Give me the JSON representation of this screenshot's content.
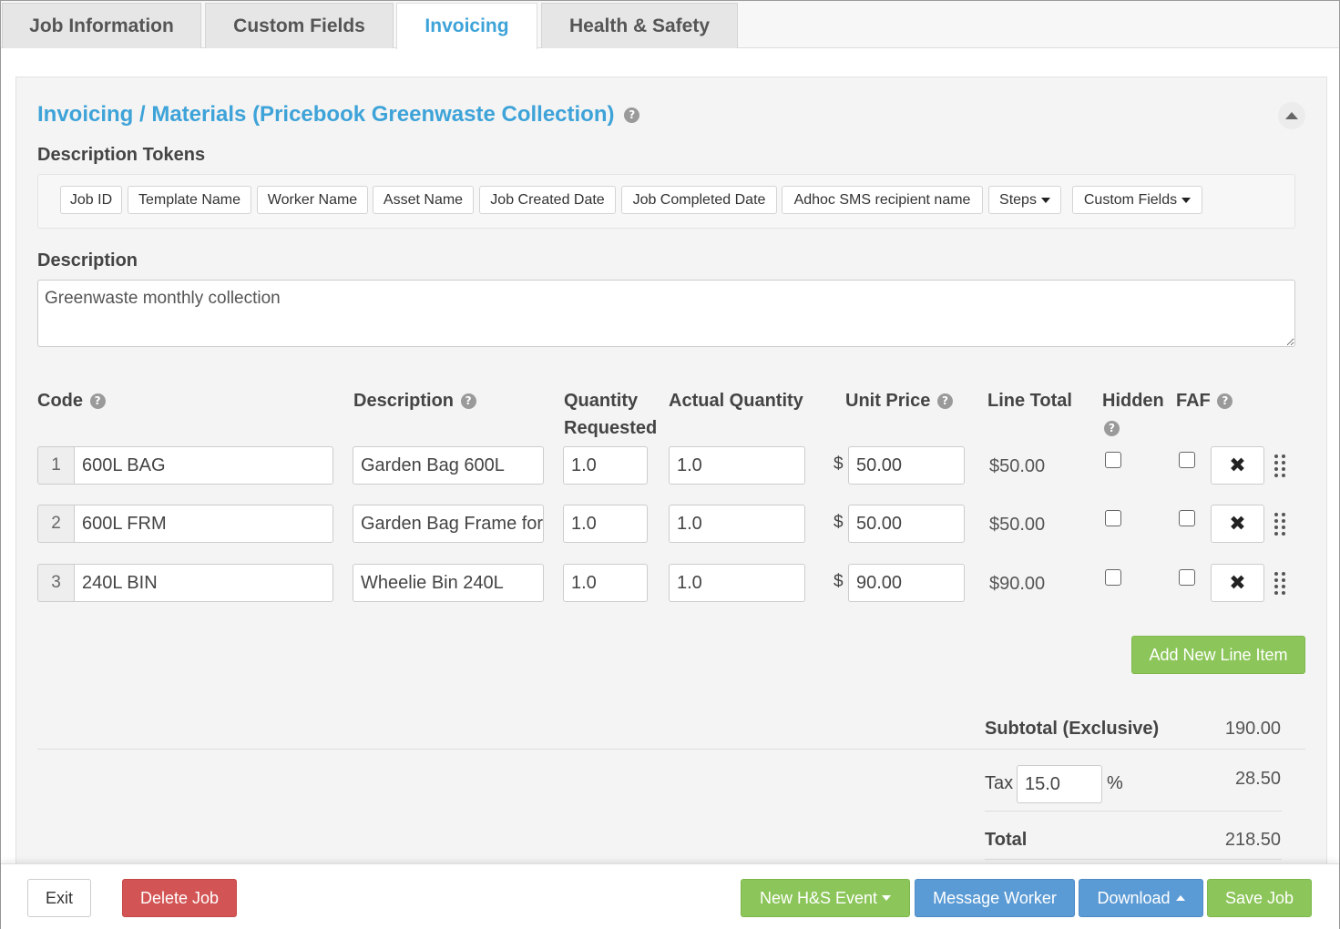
{
  "tabs": [
    {
      "label": "Job Information"
    },
    {
      "label": "Custom Fields"
    },
    {
      "label": "Invoicing",
      "active": true
    },
    {
      "label": "Health & Safety"
    }
  ],
  "section": {
    "title": "Invoicing / Materials (Pricebook Greenwaste Collection)",
    "help": "?"
  },
  "tokens": {
    "label": "Description Tokens",
    "items": [
      "Job ID",
      "Template Name",
      "Worker Name",
      "Asset Name",
      "Job Created Date",
      "Job Completed Date",
      "Adhoc SMS recipient name"
    ],
    "dropdowns": [
      "Steps",
      "Custom Fields"
    ]
  },
  "description": {
    "label": "Description",
    "value": "Greenwaste monthly collection"
  },
  "columns": {
    "code": "Code",
    "description": "Description",
    "qty_requested_1": "Quantity",
    "qty_requested_2": "Requested",
    "actual_quantity": "Actual Quantity",
    "unit_price": "Unit Price",
    "line_total": "Line Total",
    "hidden": "Hidden",
    "faf": "FAF"
  },
  "currency_symbol": "$",
  "line_items": [
    {
      "num": "1",
      "code": "600L BAG",
      "description": "Garden Bag 600L",
      "qty_requested": "1.0",
      "actual_qty": "1.0",
      "unit_price": "50.00",
      "line_total": "$50.00"
    },
    {
      "num": "2",
      "code": "600L FRM",
      "description": "Garden Bag Frame for",
      "qty_requested": "1.0",
      "actual_qty": "1.0",
      "unit_price": "50.00",
      "line_total": "$50.00"
    },
    {
      "num": "3",
      "code": "240L BIN",
      "description": "Wheelie Bin 240L",
      "qty_requested": "1.0",
      "actual_qty": "1.0",
      "unit_price": "90.00",
      "line_total": "$90.00"
    }
  ],
  "add_line_item": "Add New Line Item",
  "summary": {
    "subtotal_label": "Subtotal (Exclusive)",
    "subtotal_value": "190.00",
    "tax_label": "Tax",
    "tax_rate": "15.0",
    "tax_percent": "%",
    "tax_value": "28.50",
    "total_label": "Total",
    "total_value": "218.50"
  },
  "footer": {
    "exit": "Exit",
    "delete_job": "Delete Job",
    "new_hs_event": "New H&S Event",
    "message_worker": "Message Worker",
    "download": "Download",
    "save_job": "Save Job"
  },
  "colors": {
    "accent": "#3ea3d8",
    "green": "#8cc65a",
    "blue": "#5b9bd5",
    "red": "#d35454"
  }
}
